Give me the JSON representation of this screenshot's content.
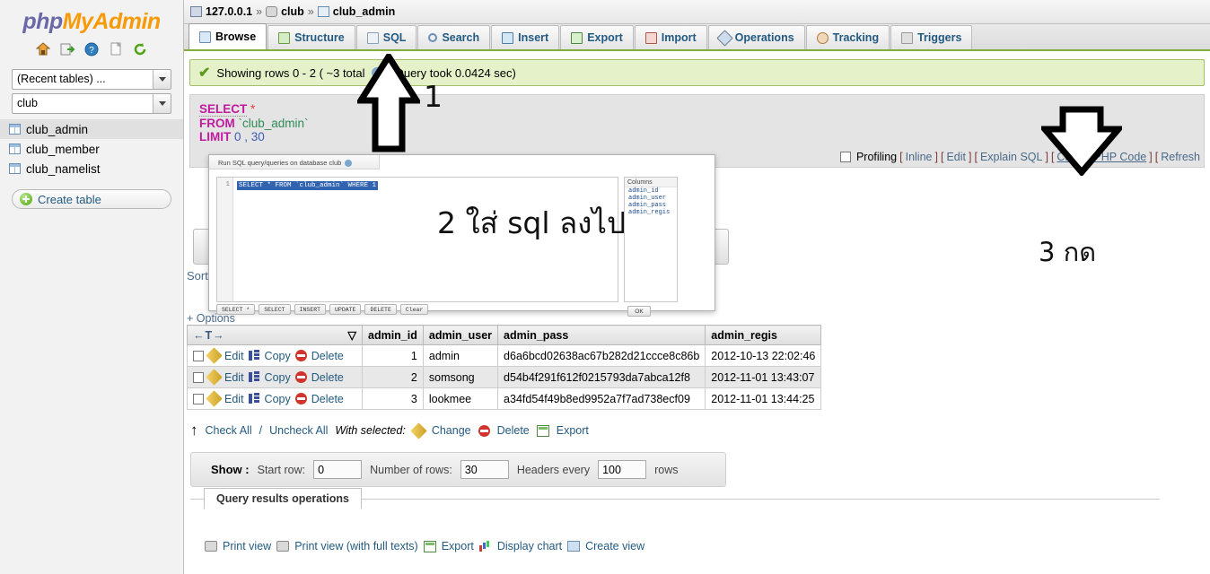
{
  "app": {
    "logo_php": "php",
    "logo_my": "My",
    "logo_admin": "Admin",
    "icons": [
      "home-icon",
      "logout-icon",
      "help-icon",
      "docs-icon",
      "reload-icon"
    ]
  },
  "sidebar": {
    "recent_select": "(Recent tables) ...",
    "db_select": "club",
    "tables": [
      {
        "label": "club_admin",
        "selected": true
      },
      {
        "label": "club_member",
        "selected": false
      },
      {
        "label": "club_namelist",
        "selected": false
      }
    ],
    "create_table": "Create table"
  },
  "breadcrumb": {
    "server": "127.0.0.1",
    "database": "club",
    "table": "club_admin",
    "separator": "»"
  },
  "tabs": [
    {
      "label": "Browse",
      "icon": "browse-icon",
      "active": true
    },
    {
      "label": "Structure",
      "icon": "structure-icon",
      "active": false
    },
    {
      "label": "SQL",
      "icon": "sql-icon",
      "active": false
    },
    {
      "label": "Search",
      "icon": "search-icon",
      "active": false
    },
    {
      "label": "Insert",
      "icon": "insert-icon",
      "active": false
    },
    {
      "label": "Export",
      "icon": "export-icon",
      "active": false
    },
    {
      "label": "Import",
      "icon": "import-icon",
      "active": false
    },
    {
      "label": "Operations",
      "icon": "wrench-icon",
      "active": false
    },
    {
      "label": "Tracking",
      "icon": "eye-icon",
      "active": false
    },
    {
      "label": "Triggers",
      "icon": "triggers-icon",
      "active": false
    }
  ],
  "message": {
    "text_before": "Showing rows 0 - 2 ( ~3 total",
    "text_after": ", Query took 0.0424 sec)"
  },
  "sql_display": {
    "line1_kw": "SELECT",
    "line1_star": "*",
    "line2_kw": "FROM",
    "line2_table": "`club_admin`",
    "line3_kw": "LIMIT",
    "line3_args": "0 , 30"
  },
  "query_tools": {
    "profiling": "Profiling",
    "inline": "Inline",
    "edit": "Edit",
    "explain": "Explain SQL",
    "create_php": "Create PHP Code",
    "refresh": "Refresh",
    "open_bracket": "[",
    "close_bracket": "]"
  },
  "sort_label": "Sort",
  "options_link": "+ Options",
  "results": {
    "ctrl_header": "←T→",
    "columns": [
      "admin_id",
      "admin_user",
      "admin_pass",
      "admin_regis"
    ],
    "actions": {
      "edit": "Edit",
      "copy": "Copy",
      "delete": "Delete"
    },
    "rows": [
      {
        "admin_id": "1",
        "admin_user": "admin",
        "admin_pass": "d6a6bcd02638ac67b282d21ccce8c86b",
        "admin_regis": "2012-10-13 22:02:46"
      },
      {
        "admin_id": "2",
        "admin_user": "somsong",
        "admin_pass": "d54b4f291f612f0215793da7abca12f8",
        "admin_regis": "2012-11-01 13:43:07"
      },
      {
        "admin_id": "3",
        "admin_user": "lookmee",
        "admin_pass": "a34fd54f49b8ed9952a7f7ad738ecf09",
        "admin_regis": "2012-11-01 13:44:25"
      }
    ]
  },
  "with_selected": {
    "check_all": "Check All",
    "slash": "/",
    "uncheck_all": "Uncheck All",
    "label": "With selected:",
    "change": "Change",
    "delete": "Delete",
    "export": "Export"
  },
  "show_bar": {
    "show_label": "Show :",
    "start_row_label": "Start row:",
    "start_row_value": "0",
    "num_rows_label": "Number of rows:",
    "num_rows_value": "30",
    "headers_label": "Headers every",
    "headers_value": "100",
    "rows_suffix": "rows"
  },
  "query_results_operations": {
    "legend": "Query results operations",
    "print_view": "Print view",
    "print_view_full": "Print view (with full texts)",
    "export": "Export",
    "display_chart": "Display chart",
    "create_view": "Create view"
  },
  "dialog": {
    "title": "Run SQL query/queries on database club",
    "line_number": "1",
    "sql_text": "SELECT * FROM `club_admin` WHERE 1",
    "columns_title": "Columns",
    "columns": [
      "admin_id",
      "admin_user",
      "admin_pass",
      "admin_regis"
    ],
    "buttons": [
      "SELECT *",
      "SELECT",
      "INSERT",
      "UPDATE",
      "DELETE",
      "Clear"
    ],
    "ok_button": "OK"
  },
  "annotations": {
    "step1": "1",
    "step2": "2 ใส่ sql ลงไป",
    "step3": "3 กด"
  },
  "colors": {
    "accent_green": "#7fae3a",
    "message_bg": "#e5f2c9",
    "link_blue": "#235a81",
    "logo_orange": "#f89a05",
    "logo_purple": "#6b68a8"
  }
}
